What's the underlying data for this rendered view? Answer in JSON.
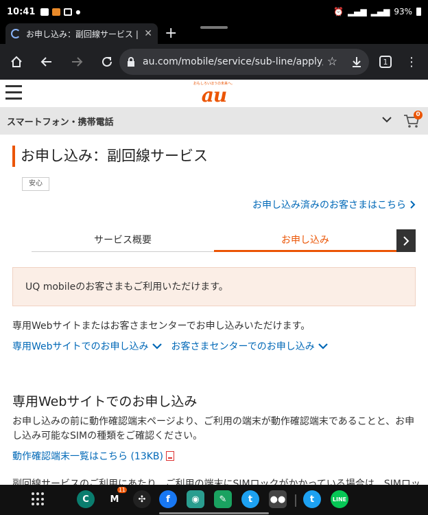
{
  "status_bar": {
    "time": "10:41",
    "battery": "93%"
  },
  "browser": {
    "tab_title": "お申し込み：副回線サービス | サ",
    "url": "au.com/mobile/service/sub-line/apply/",
    "tab_count": "1"
  },
  "site": {
    "logo_text": "au",
    "logo_tagline": "おもしろいほうの未来へ。",
    "category": "スマートフォン・携帯電話",
    "cart_count": "0"
  },
  "page": {
    "title": "お申し込み：副回線サービス",
    "tag": "安心",
    "existing_customer_link": "お申し込み済みのお客さまはこちら",
    "tabs": [
      {
        "label": "サービス概要"
      },
      {
        "label": "お申し込み"
      }
    ],
    "notice": "UQ mobileのお客さまもご利用いただけます。",
    "intro": "専用Webサイトまたはお客さまセンターでお申し込みいただけます。",
    "anchors": [
      {
        "label": "専用Webサイトでのお申し込み"
      },
      {
        "label": "お客さまセンターでのお申し込み"
      }
    ],
    "section_title": "専用Webサイトでのお申し込み",
    "section_body": "お申し込みの前に動作確認端末ページより、ご利用の端末が動作確認端末であることと、お申し込み可能なSIMの種類をご確認ください。",
    "pdf_link": "動作確認端末一覧はこちら (13KB)",
    "cut_text": "副回線サービスのご利用にあたり、ご利用の端末にSIMロックがかかっている場合は、SIMロッ"
  },
  "taskbar": {
    "gmail_badge": "11"
  },
  "colors": {
    "accent": "#eb5505",
    "link": "#0068b7"
  }
}
